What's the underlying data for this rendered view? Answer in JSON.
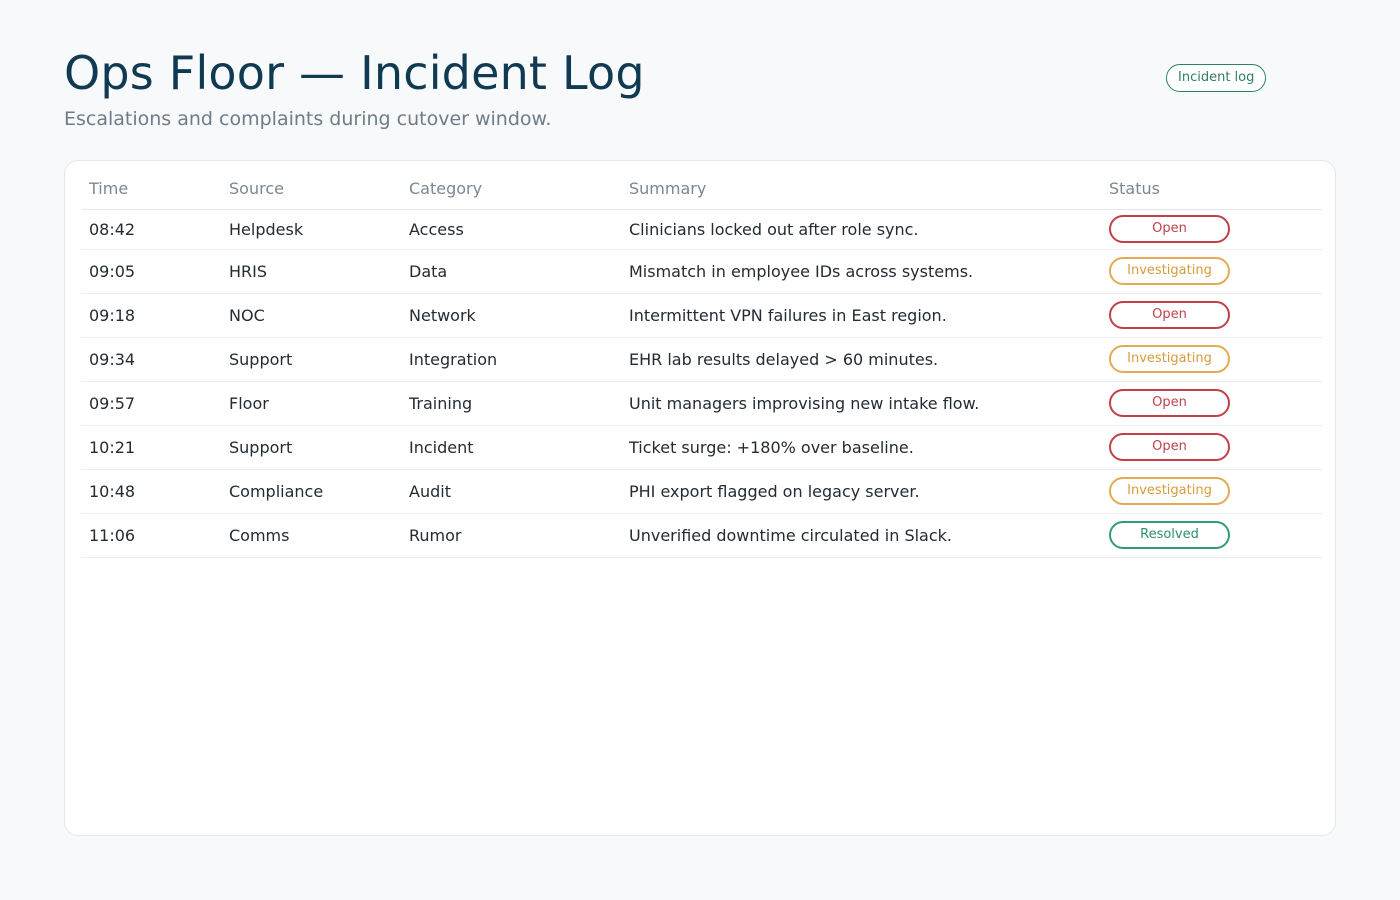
{
  "header": {
    "title": "Ops Floor — Incident Log",
    "subtitle": "Escalations and complaints during cutover window.",
    "badge": "Incident log"
  },
  "table": {
    "columns": [
      "Time",
      "Source",
      "Category",
      "Summary",
      "Status"
    ],
    "rows": [
      {
        "time": "08:42",
        "source": "Helpdesk",
        "category": "Access",
        "summary": "Clinicians locked out after role sync.",
        "status": "Open"
      },
      {
        "time": "09:05",
        "source": "HRIS",
        "category": "Data",
        "summary": "Mismatch in employee IDs across systems.",
        "status": "Investigating"
      },
      {
        "time": "09:18",
        "source": "NOC",
        "category": "Network",
        "summary": "Intermittent VPN failures in East region.",
        "status": "Open"
      },
      {
        "time": "09:34",
        "source": "Support",
        "category": "Integration",
        "summary": "EHR lab results delayed > 60 minutes.",
        "status": "Investigating"
      },
      {
        "time": "09:57",
        "source": "Floor",
        "category": "Training",
        "summary": "Unit managers improvising new intake flow.",
        "status": "Open"
      },
      {
        "time": "10:21",
        "source": "Support",
        "category": "Incident",
        "summary": "Ticket surge: +180% over baseline.",
        "status": "Open"
      },
      {
        "time": "10:48",
        "source": "Compliance",
        "category": "Audit",
        "summary": "PHI export flagged on legacy server.",
        "status": "Investigating"
      },
      {
        "time": "11:06",
        "source": "Comms",
        "category": "Rumor",
        "summary": "Unverified downtime circulated in Slack.",
        "status": "Resolved"
      }
    ]
  },
  "colors": {
    "title": "#0f3a52",
    "status_open": "#c0414a",
    "status_investigating": "#e3ac52",
    "status_resolved": "#2f9c77",
    "badge": "#2f7f64"
  }
}
